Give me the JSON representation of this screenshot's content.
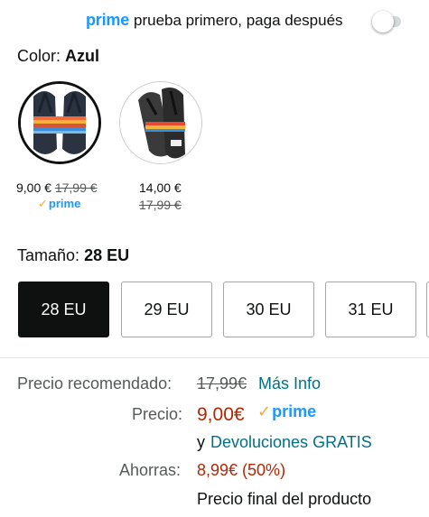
{
  "prime_bar": {
    "prime": "prime",
    "text": "prueba primero, paga después",
    "toggle_on": false
  },
  "color": {
    "label": "Color:",
    "selected": "Azul",
    "options": [
      {
        "price": "9,00 €",
        "original": "17,99 €",
        "prime": "prime",
        "selected": true
      },
      {
        "price": "14,00 €",
        "original": "17,99 €",
        "selected": false
      }
    ]
  },
  "size": {
    "label": "Tamaño:",
    "selected": "28 EU",
    "options": [
      "28 EU",
      "29 EU",
      "30 EU",
      "31 EU"
    ]
  },
  "pricing": {
    "recommended_label": "Precio recomendado:",
    "recommended_value": "17,99€",
    "more_info": "Más Info",
    "price_label": "Precio:",
    "price_value": "9,00€",
    "prime": "prime",
    "and_text": "y",
    "returns_link": "Devoluciones GRATIS",
    "savings_label": "Ahorras:",
    "savings_value": "8,99€ (50%)",
    "final_note": "Precio final del producto"
  },
  "colors": {
    "prime_blue": "#1a98ff",
    "price_red": "#b12704",
    "link_teal": "#007185",
    "check_orange": "#f3a847"
  }
}
